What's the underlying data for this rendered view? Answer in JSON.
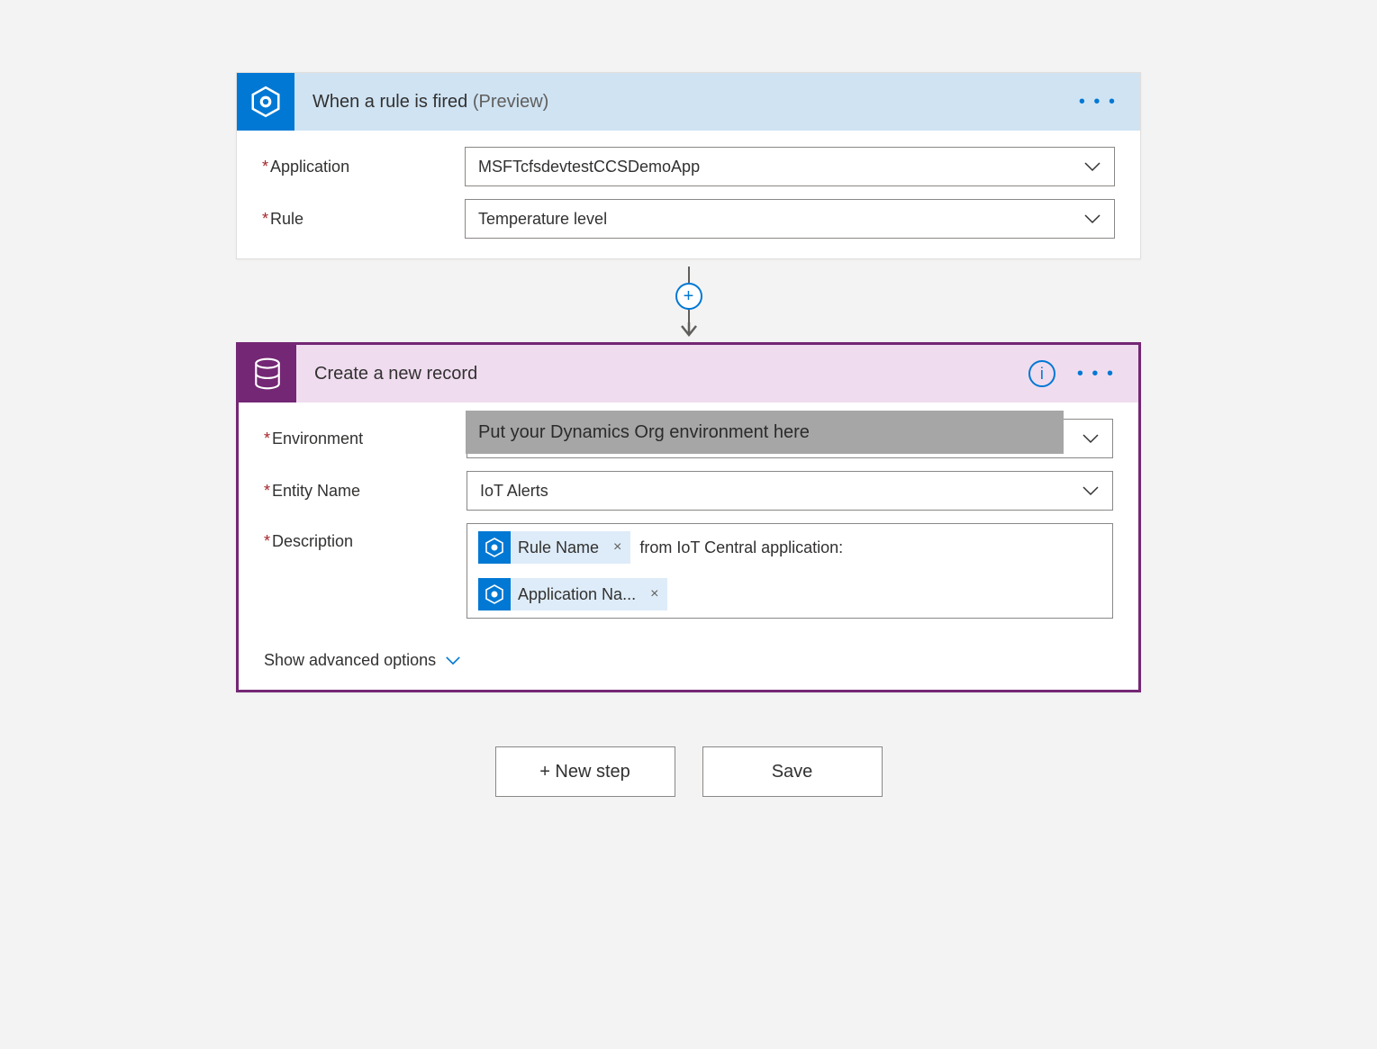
{
  "trigger": {
    "title": "When a rule is fired",
    "preview_suffix": "(Preview)",
    "fields": {
      "application": {
        "label": "Application",
        "value": "MSFTcfsdevtestCCSDemoApp",
        "required": true
      },
      "rule": {
        "label": "Rule",
        "value": "Temperature level",
        "required": true
      }
    }
  },
  "action": {
    "title": "Create a new record",
    "fields": {
      "environment": {
        "label": "Environment",
        "placeholder": "Put your Dynamics Org environment here",
        "required": true
      },
      "entity": {
        "label": "Entity Name",
        "value": "IoT Alerts",
        "required": true
      },
      "description": {
        "label": "Description",
        "required": true,
        "tokens": [
          {
            "label": "Rule Name"
          },
          {
            "label": "Application Na..."
          }
        ],
        "inline_text": "from IoT Central application:"
      }
    },
    "advanced_toggle": "Show advanced options"
  },
  "footer": {
    "new_step": "+ New step",
    "save": "Save"
  },
  "glyphs": {
    "req": "*",
    "x": "×",
    "plus": "+"
  }
}
